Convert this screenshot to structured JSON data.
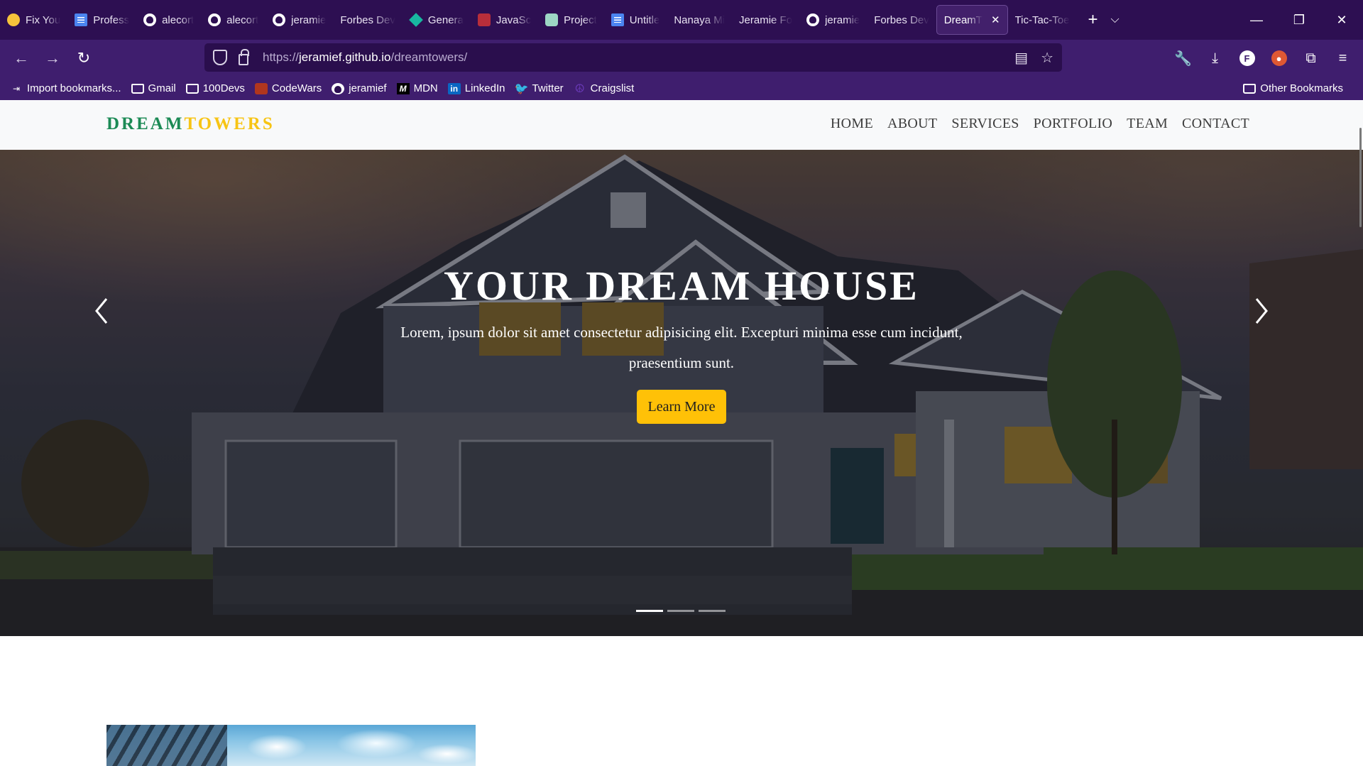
{
  "browser": {
    "tabs": [
      {
        "title": "Fix You",
        "icon": "smile-icon"
      },
      {
        "title": "Profess",
        "icon": "docs-icon"
      },
      {
        "title": "alecort",
        "icon": "github-icon"
      },
      {
        "title": "alecort",
        "icon": "github-icon"
      },
      {
        "title": "jeramie",
        "icon": "github-icon"
      },
      {
        "title": "Forbes Dev",
        "icon": "none"
      },
      {
        "title": "Genera",
        "icon": "diamond-icon"
      },
      {
        "title": "JavaSc",
        "icon": "js-icon"
      },
      {
        "title": "Project",
        "icon": "chatgpt-icon"
      },
      {
        "title": "Untitle",
        "icon": "docs-icon"
      },
      {
        "title": "Nanaya Mi",
        "icon": "none"
      },
      {
        "title": "Jeramie Fo",
        "icon": "none"
      },
      {
        "title": "jeramie",
        "icon": "github-icon"
      },
      {
        "title": "Forbes Dev",
        "icon": "none"
      },
      {
        "title": "DreamT",
        "icon": "none",
        "active": true
      },
      {
        "title": "Tic-Tac-Toe",
        "icon": "none"
      }
    ],
    "url_prefix": "https://",
    "url_domain": "jeramief.github.io",
    "url_path": "/dreamtowers/",
    "bookmarks": [
      {
        "label": "Import bookmarks...",
        "icon": "import-icon"
      },
      {
        "label": "Gmail",
        "icon": "folder-icon"
      },
      {
        "label": "100Devs",
        "icon": "folder-icon"
      },
      {
        "label": "CodeWars",
        "icon": "codewars-icon"
      },
      {
        "label": "jeramief",
        "icon": "github-icon"
      },
      {
        "label": "MDN",
        "icon": "mdn-icon"
      },
      {
        "label": "LinkedIn",
        "icon": "linkedin-icon"
      },
      {
        "label": "Twitter",
        "icon": "twitter-icon"
      },
      {
        "label": "Craigslist",
        "icon": "peace-icon"
      }
    ],
    "other_bookmarks": "Other Bookmarks"
  },
  "site": {
    "brand_part1": "DREAM",
    "brand_part2": "TOWERS",
    "brand_colors": {
      "dream": "#1c8a55",
      "towers": "#f7c414"
    },
    "menu": [
      "HOME",
      "ABOUT",
      "SERVICES",
      "PORTFOLIO",
      "TEAM",
      "CONTACT"
    ],
    "hero": {
      "title": "YOUR DREAM HOUSE",
      "text": "Lorem, ipsum dolor sit amet consectetur adipisicing elit. Excepturi minima esse cum incidunt, praesentium sunt.",
      "button": "Learn More",
      "button_color": "#ffc107",
      "slides": 3,
      "active_slide": 1
    }
  }
}
